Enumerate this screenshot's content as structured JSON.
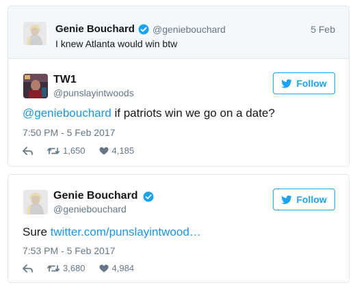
{
  "quoted": {
    "name": "Genie Bouchard",
    "handle": "@geniebouchard",
    "date": "5 Feb",
    "text": "I knew Atlanta would win btw"
  },
  "reply": {
    "name": "TW1",
    "handle": "@punslayintwoods",
    "follow_label": "Follow",
    "mention": "@geniebouchard",
    "text": " if patriots win we go on a date?",
    "timestamp": "7:50 PM - 5 Feb 2017",
    "retweets": "1,650",
    "likes": "4,185"
  },
  "main": {
    "name": "Genie Bouchard",
    "handle": "@geniebouchard",
    "follow_label": "Follow",
    "text_prefix": "Sure ",
    "link": "twitter.com/punslayintwood…",
    "timestamp": "7:53 PM - 5 Feb 2017",
    "retweets": "3,680",
    "likes": "4,984"
  },
  "colors": {
    "accent": "#1da1f2",
    "link": "#1b95e0",
    "muted": "#657786",
    "verified": "#1da1f2"
  }
}
